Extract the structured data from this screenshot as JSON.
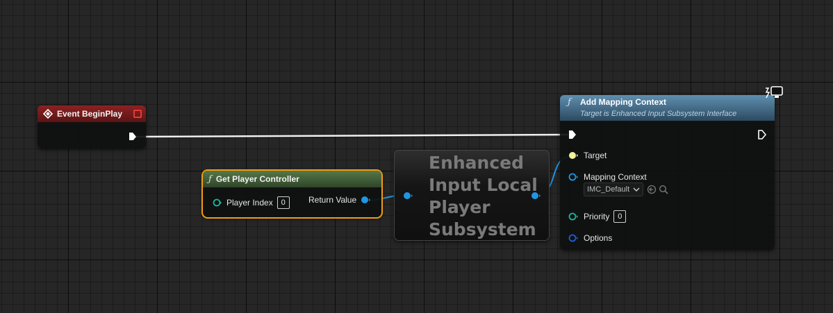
{
  "colors": {
    "event_header": "#7a1c1c",
    "pure_fn_header": "#4a6b3a",
    "call_fn_header": "#4e7fa0",
    "exec_wire": "#f0f0f0",
    "object_pin": "#1e96e6",
    "byte_pin": "#1fb59a",
    "target_pin": "#f4f29a",
    "options_pin": "#1c5ed6",
    "selection_outline": "#f39c12"
  },
  "event_node": {
    "title": "Event BeginPlay",
    "icon": "event-diamond-icon"
  },
  "get_player_controller": {
    "title": "Get Player Controller",
    "icon": "function-f-icon",
    "input_label": "Player Index",
    "input_value": "0",
    "output_label": "Return Value"
  },
  "subsystem_node": {
    "title_lines": [
      "Enhanced",
      "Input Local",
      "Player",
      "Subsystem"
    ]
  },
  "add_mapping_context": {
    "title": "Add Mapping Context",
    "subtitle": "Target is Enhanced Input Subsystem Interface",
    "icon": "function-f-icon",
    "target_label": "Target",
    "mapping_label": "Mapping Context",
    "mapping_value": "IMC_Default",
    "priority_label": "Priority",
    "priority_value": "0",
    "options_label": "Options",
    "corner_icon": "client-monitor-icon"
  }
}
